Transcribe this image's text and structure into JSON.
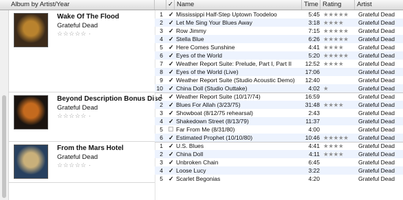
{
  "header": {
    "album_col": "Album by Artist/Year",
    "check_col": "✓",
    "name_col": "Name",
    "time_col": "Time",
    "rating_col": "Rating",
    "artist_col": "Artist"
  },
  "albums": [
    {
      "title": "Wake Of The Flood",
      "artist": "Grateful Dead",
      "rating": "☆☆☆☆☆ ·",
      "art_colors": [
        "#3b2a1a",
        "#b9832e"
      ],
      "tracks": [
        {
          "num": "1",
          "checked": true,
          "name": "Mississippi Half-Step Uptown Toodeloo",
          "time": "5:45",
          "rating": "★★★★★",
          "artist": "Grateful Dead"
        },
        {
          "num": "2",
          "checked": true,
          "name": "Let Me Sing Your Blues Away",
          "time": "3:18",
          "rating": "★★★★",
          "artist": "Grateful Dead"
        },
        {
          "num": "3",
          "checked": true,
          "name": "Row Jimmy",
          "time": "7:15",
          "rating": "★★★★★",
          "artist": "Grateful Dead"
        },
        {
          "num": "4",
          "checked": true,
          "name": "Stella Blue",
          "time": "6:26",
          "rating": "★★★★★",
          "artist": "Grateful Dead"
        },
        {
          "num": "5",
          "checked": true,
          "name": "Here Comes Sunshine",
          "time": "4:41",
          "rating": "★★★★",
          "artist": "Grateful Dead"
        },
        {
          "num": "6",
          "checked": true,
          "name": "Eyes of the World",
          "time": "5:20",
          "rating": "★★★★★",
          "artist": "Grateful Dead"
        },
        {
          "num": "7",
          "checked": true,
          "name": "Weather Report Suite: Prelude, Part I, Part II",
          "time": "12:52",
          "rating": "★★★★",
          "artist": "Grateful Dead"
        },
        {
          "num": "8",
          "checked": true,
          "name": "Eyes of the World (Live)",
          "time": "17:06",
          "rating": "",
          "artist": "Grateful Dead"
        },
        {
          "num": "9",
          "checked": true,
          "name": "Weather Report Suite (Studio Acoustic Demo)",
          "time": "12:40",
          "rating": "",
          "artist": "Grateful Dead"
        },
        {
          "num": "10",
          "checked": true,
          "name": "China Doll (Studio Outtake)",
          "time": "4:02",
          "rating": "★",
          "artist": "Grateful Dead"
        }
      ]
    },
    {
      "title": "Beyond Description Bonus Disc",
      "artist": "Grateful Dead",
      "rating": "☆☆☆☆☆ ·",
      "art_colors": [
        "#1a1410",
        "#c46a1e"
      ],
      "tracks": [
        {
          "num": "1",
          "checked": true,
          "name": "Weather Report Suite (10/17/74)",
          "time": "16:59",
          "rating": "",
          "artist": "Grateful Dead"
        },
        {
          "num": "2",
          "checked": true,
          "name": "Blues For Allah (3/23/75)",
          "time": "31:48",
          "rating": "★★★★",
          "artist": "Grateful Dead"
        },
        {
          "num": "3",
          "checked": true,
          "name": "Showboat (8/12/75 rehearsal)",
          "time": "2:43",
          "rating": "",
          "artist": "Grateful Dead"
        },
        {
          "num": "4",
          "checked": true,
          "name": "Shakedown Street (8/13/79)",
          "time": "11:37",
          "rating": "",
          "artist": "Grateful Dead"
        },
        {
          "num": "5",
          "checked": false,
          "name": "Far From Me (8/31/80)",
          "time": "4:00",
          "rating": "",
          "artist": "Grateful Dead"
        },
        {
          "num": "6",
          "checked": true,
          "name": "Estimated Prophet (10/10/80)",
          "time": "10:46",
          "rating": "★★★★★",
          "artist": "Grateful Dead"
        }
      ]
    },
    {
      "title": "From the Mars Hotel",
      "artist": "Grateful Dead",
      "rating": "☆☆☆☆☆ ·",
      "art_colors": [
        "#27405f",
        "#c9b07a"
      ],
      "tracks": [
        {
          "num": "1",
          "checked": true,
          "name": "U.S. Blues",
          "time": "4:41",
          "rating": "★★★★",
          "artist": "Grateful Dead"
        },
        {
          "num": "2",
          "checked": true,
          "name": "China Doll",
          "time": "4:11",
          "rating": "★★★★",
          "artist": "Grateful Dead"
        },
        {
          "num": "3",
          "checked": true,
          "name": "Unbroken Chain",
          "time": "6:45",
          "rating": "",
          "artist": "Grateful Dead"
        },
        {
          "num": "4",
          "checked": true,
          "name": "Loose Lucy",
          "time": "3:22",
          "rating": "",
          "artist": "Grateful Dead"
        },
        {
          "num": "5",
          "checked": true,
          "name": "Scarlet Begonias",
          "time": "4:20",
          "rating": "",
          "artist": "Grateful Dead"
        }
      ]
    }
  ]
}
